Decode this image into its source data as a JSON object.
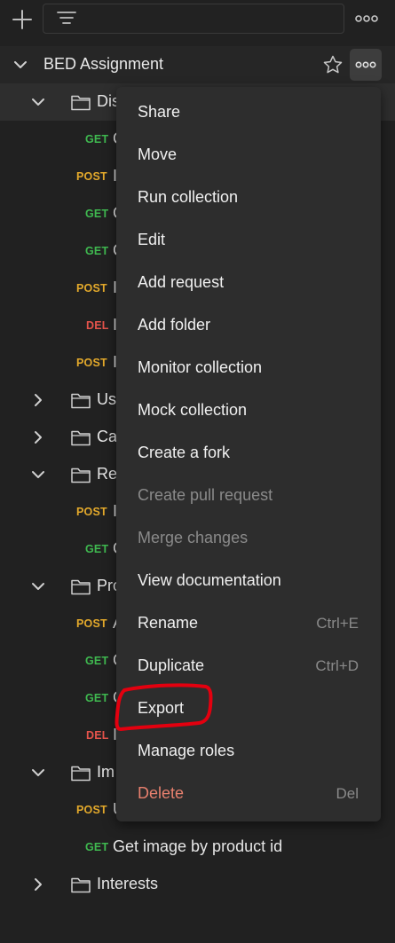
{
  "collection": {
    "title": "BED Assignment"
  },
  "tree": [
    {
      "kind": "folder",
      "label": "Dis",
      "expanded": true,
      "highlight": true
    },
    {
      "kind": "request",
      "method": "GET",
      "label": "C"
    },
    {
      "kind": "request",
      "method": "POST",
      "label": "I"
    },
    {
      "kind": "request",
      "method": "GET",
      "label": "C"
    },
    {
      "kind": "request",
      "method": "GET",
      "label": "C"
    },
    {
      "kind": "request",
      "method": "POST",
      "label": "I"
    },
    {
      "kind": "request",
      "method": "DEL",
      "label": "I"
    },
    {
      "kind": "request",
      "method": "POST",
      "label": "I"
    },
    {
      "kind": "folder",
      "label": "Us",
      "expanded": false
    },
    {
      "kind": "folder",
      "label": "Ca",
      "expanded": false
    },
    {
      "kind": "folder",
      "label": "Re",
      "expanded": true
    },
    {
      "kind": "request",
      "method": "POST",
      "label": "I"
    },
    {
      "kind": "request",
      "method": "GET",
      "label": "C"
    },
    {
      "kind": "folder",
      "label": "Pro",
      "expanded": true
    },
    {
      "kind": "request",
      "method": "POST",
      "label": "A"
    },
    {
      "kind": "request",
      "method": "GET",
      "label": "C"
    },
    {
      "kind": "request",
      "method": "GET",
      "label": "C"
    },
    {
      "kind": "request",
      "method": "DEL",
      "label": "I"
    },
    {
      "kind": "folder",
      "label": "Im",
      "expanded": true
    },
    {
      "kind": "request",
      "method": "POST",
      "label": "U"
    },
    {
      "kind": "request",
      "method": "GET",
      "label": "Get image by product id"
    },
    {
      "kind": "folder",
      "label": "Interests",
      "expanded": false
    }
  ],
  "menu": {
    "items": [
      {
        "label": "Share",
        "shortcut": "",
        "state": "normal"
      },
      {
        "label": "Move",
        "shortcut": "",
        "state": "normal"
      },
      {
        "label": "Run collection",
        "shortcut": "",
        "state": "normal"
      },
      {
        "label": "Edit",
        "shortcut": "",
        "state": "normal"
      },
      {
        "label": "Add request",
        "shortcut": "",
        "state": "normal"
      },
      {
        "label": "Add folder",
        "shortcut": "",
        "state": "normal"
      },
      {
        "label": "Monitor collection",
        "shortcut": "",
        "state": "normal"
      },
      {
        "label": "Mock collection",
        "shortcut": "",
        "state": "normal"
      },
      {
        "label": "Create a fork",
        "shortcut": "",
        "state": "normal"
      },
      {
        "label": "Create pull request",
        "shortcut": "",
        "state": "disabled"
      },
      {
        "label": "Merge changes",
        "shortcut": "",
        "state": "disabled"
      },
      {
        "label": "View documentation",
        "shortcut": "",
        "state": "normal"
      },
      {
        "label": "Rename",
        "shortcut": "Ctrl+E",
        "state": "normal"
      },
      {
        "label": "Duplicate",
        "shortcut": "Ctrl+D",
        "state": "normal"
      },
      {
        "label": "Export",
        "shortcut": "",
        "state": "normal"
      },
      {
        "label": "Manage roles",
        "shortcut": "",
        "state": "normal"
      },
      {
        "label": "Delete",
        "shortcut": "Del",
        "state": "danger"
      }
    ]
  },
  "colors": {
    "background": "#212121",
    "menu": "#2d2d2d",
    "get": "#3fb950",
    "post": "#e3a92b",
    "del": "#e5534b",
    "danger_text": "#e8806e",
    "annotation": "#e3000f"
  },
  "icons": [
    "plus-icon",
    "filter-icon",
    "more-icon",
    "chevron-down-icon",
    "chevron-right-icon",
    "star-icon",
    "folder-icon"
  ]
}
